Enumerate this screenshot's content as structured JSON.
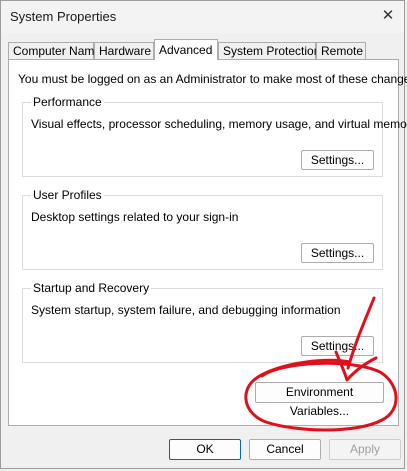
{
  "window": {
    "title": "System Properties",
    "close_glyph": "✕"
  },
  "tabs": [
    {
      "label": "Computer Name",
      "active": false
    },
    {
      "label": "Hardware",
      "active": false
    },
    {
      "label": "Advanced",
      "active": true
    },
    {
      "label": "System Protection",
      "active": false
    },
    {
      "label": "Remote",
      "active": false
    }
  ],
  "advanced": {
    "admin_note": "You must be logged on as an Administrator to make most of these changes.",
    "performance": {
      "label": "Performance",
      "description": "Visual effects, processor scheduling, memory usage, and virtual memory",
      "button": "Settings..."
    },
    "user_profiles": {
      "label": "User Profiles",
      "description": "Desktop settings related to your sign-in",
      "button": "Settings..."
    },
    "startup_recovery": {
      "label": "Startup and Recovery",
      "description": "System startup, system failure, and debugging information",
      "button": "Settings..."
    },
    "env_vars_button": "Environment Variables..."
  },
  "footer": {
    "ok": "OK",
    "cancel": "Cancel",
    "apply": "Apply"
  },
  "annotation_color": "#e0101a"
}
